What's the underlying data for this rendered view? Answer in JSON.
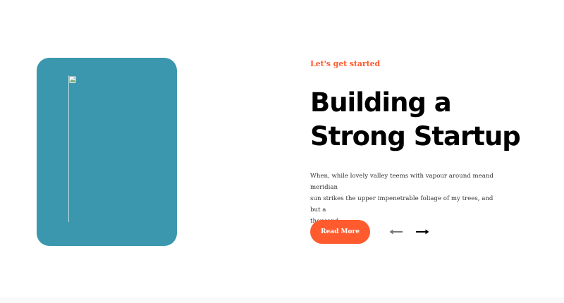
{
  "hero": {
    "eyebrow": "Let's get started",
    "headline_line1": "Building a",
    "headline_line2": "Strong Startup",
    "description_line1": "When, while lovely valley teems with vapour around meand meridian",
    "description_line2": "sun strikes the upper impenetrable foliage of my trees, and but a",
    "description_line3": "thousand.",
    "cta_label": "Read More",
    "prev_icon": "arrow-left-icon",
    "next_icon": "arrow-right-icon"
  },
  "image": {
    "icon": "broken-image-icon"
  },
  "colors": {
    "accent": "#ff5b2e",
    "card_background": "#3a97ad",
    "heading": "#000000",
    "body_text": "#333333",
    "arrow_inactive": "#777777",
    "arrow_active": "#000000"
  }
}
